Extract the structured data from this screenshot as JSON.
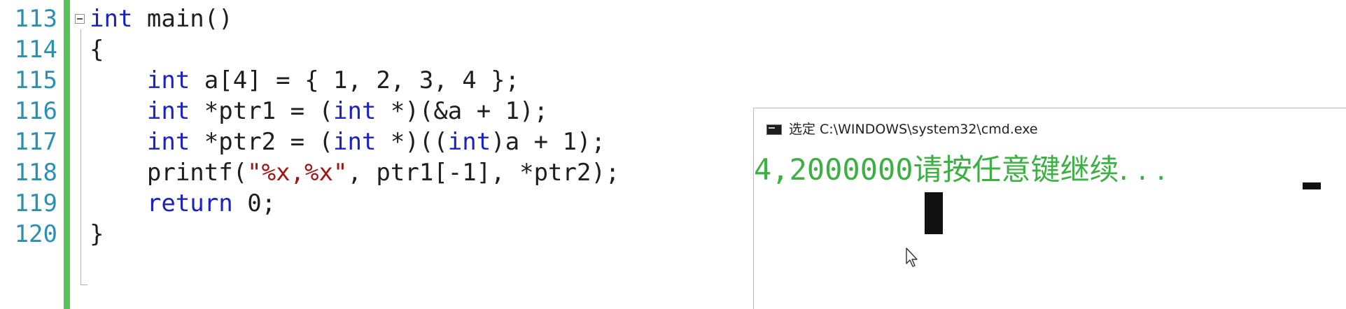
{
  "editor": {
    "line_numbers": [
      "113",
      "114",
      "115",
      "116",
      "117",
      "118",
      "119",
      "120"
    ],
    "lines": [
      [
        {
          "t": "kw",
          "v": "int"
        },
        {
          "t": "pl",
          "v": " main()"
        }
      ],
      [
        {
          "t": "pl",
          "v": "{"
        }
      ],
      [
        {
          "t": "pl",
          "v": "    "
        },
        {
          "t": "kw",
          "v": "int"
        },
        {
          "t": "pl",
          "v": " a[4] = { 1, 2, 3, 4 };"
        }
      ],
      [
        {
          "t": "pl",
          "v": "    "
        },
        {
          "t": "kw",
          "v": "int"
        },
        {
          "t": "pl",
          "v": " *ptr1 = ("
        },
        {
          "t": "kw",
          "v": "int"
        },
        {
          "t": "pl",
          "v": " *)(&a + 1);"
        }
      ],
      [
        {
          "t": "pl",
          "v": "    "
        },
        {
          "t": "kw",
          "v": "int"
        },
        {
          "t": "pl",
          "v": " *ptr2 = ("
        },
        {
          "t": "kw",
          "v": "int"
        },
        {
          "t": "pl",
          "v": " *)(("
        },
        {
          "t": "kw",
          "v": "int"
        },
        {
          "t": "pl",
          "v": ")a + 1);"
        }
      ],
      [
        {
          "t": "pl",
          "v": "    printf("
        },
        {
          "t": "str",
          "v": "\"%x,%x\""
        },
        {
          "t": "pl",
          "v": ", ptr1[-1], *ptr2);"
        }
      ],
      [
        {
          "t": "pl",
          "v": "    "
        },
        {
          "t": "kw",
          "v": "return"
        },
        {
          "t": "pl",
          "v": " 0;"
        }
      ],
      [
        {
          "t": "pl",
          "v": "}"
        }
      ]
    ],
    "colors": {
      "line_number": "#2b91af",
      "keyword": "#1a22c6",
      "string": "#a31515",
      "text": "#1e1e1e",
      "change_bar": "#57c25b"
    }
  },
  "console": {
    "icon": "cmd-icon",
    "title": "选定 C:\\WINDOWS\\system32\\cmd.exe",
    "output_value": "4,2000000",
    "output_prompt": "请按任意键继续. . .",
    "output_color": "#3cb043"
  }
}
